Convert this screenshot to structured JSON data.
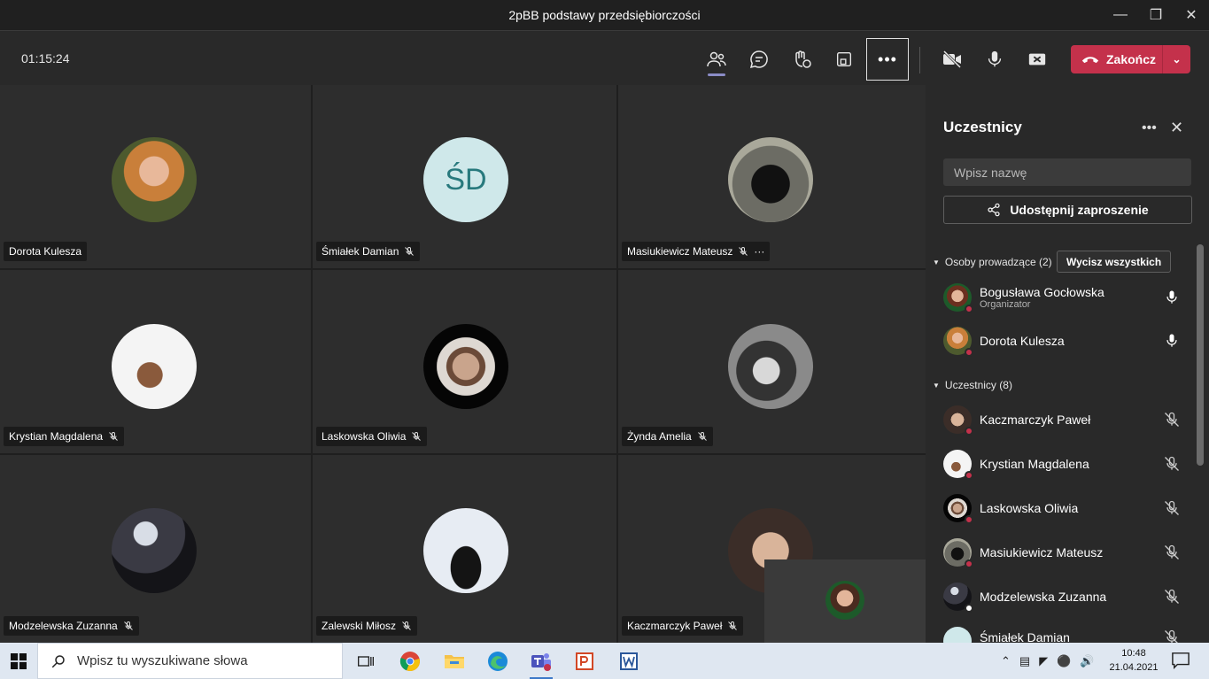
{
  "window": {
    "title": "2pBB podstawy przedsiębiorczości"
  },
  "meeting": {
    "timer": "01:15:24",
    "end_label": "Zakończ"
  },
  "tiles": [
    {
      "name": "Dorota Kulesza",
      "muted": false
    },
    {
      "name": "Śmiałek Damian",
      "muted": true,
      "initials": "ŚD"
    },
    {
      "name": "Masiukiewicz Mateusz",
      "muted": true,
      "more": "···"
    },
    {
      "name": "Krystian Magdalena",
      "muted": true
    },
    {
      "name": "Laskowska Oliwia",
      "muted": true
    },
    {
      "name": "Żynda Amelia",
      "muted": true
    },
    {
      "name": "Modzelewska Zuzanna",
      "muted": true
    },
    {
      "name": "Zalewski Miłosz",
      "muted": true
    },
    {
      "name": "Kaczmarczyk Paweł",
      "muted": true
    }
  ],
  "participants_panel": {
    "title": "Uczestnicy",
    "search_placeholder": "Wpisz nazwę",
    "share_label": "Udostępnij zaproszenie",
    "presenters_header": "Osoby prowadzące (2)",
    "mute_all_label": "Wycisz wszystkich",
    "attendees_header": "Uczestnicy (8)",
    "presenters": [
      {
        "name": "Bogusława Gocłowska",
        "role": "Organizator"
      },
      {
        "name": "Dorota Kulesza"
      }
    ],
    "attendees": [
      {
        "name": "Kaczmarczyk Paweł"
      },
      {
        "name": "Krystian Magdalena"
      },
      {
        "name": "Laskowska Oliwia"
      },
      {
        "name": "Masiukiewicz Mateusz"
      },
      {
        "name": "Modzelewska Zuzanna"
      },
      {
        "name": "Śmiałek Damian"
      }
    ]
  },
  "taskbar": {
    "search_placeholder": "Wpisz tu wyszukiwane słowa",
    "time": "10:48",
    "date": "21.04.2021"
  },
  "colors": {
    "accent": "#8b8cc7",
    "end_call": "#c4314b",
    "initials_bg": "#cfe8ea",
    "initials_fg": "#28797d"
  }
}
